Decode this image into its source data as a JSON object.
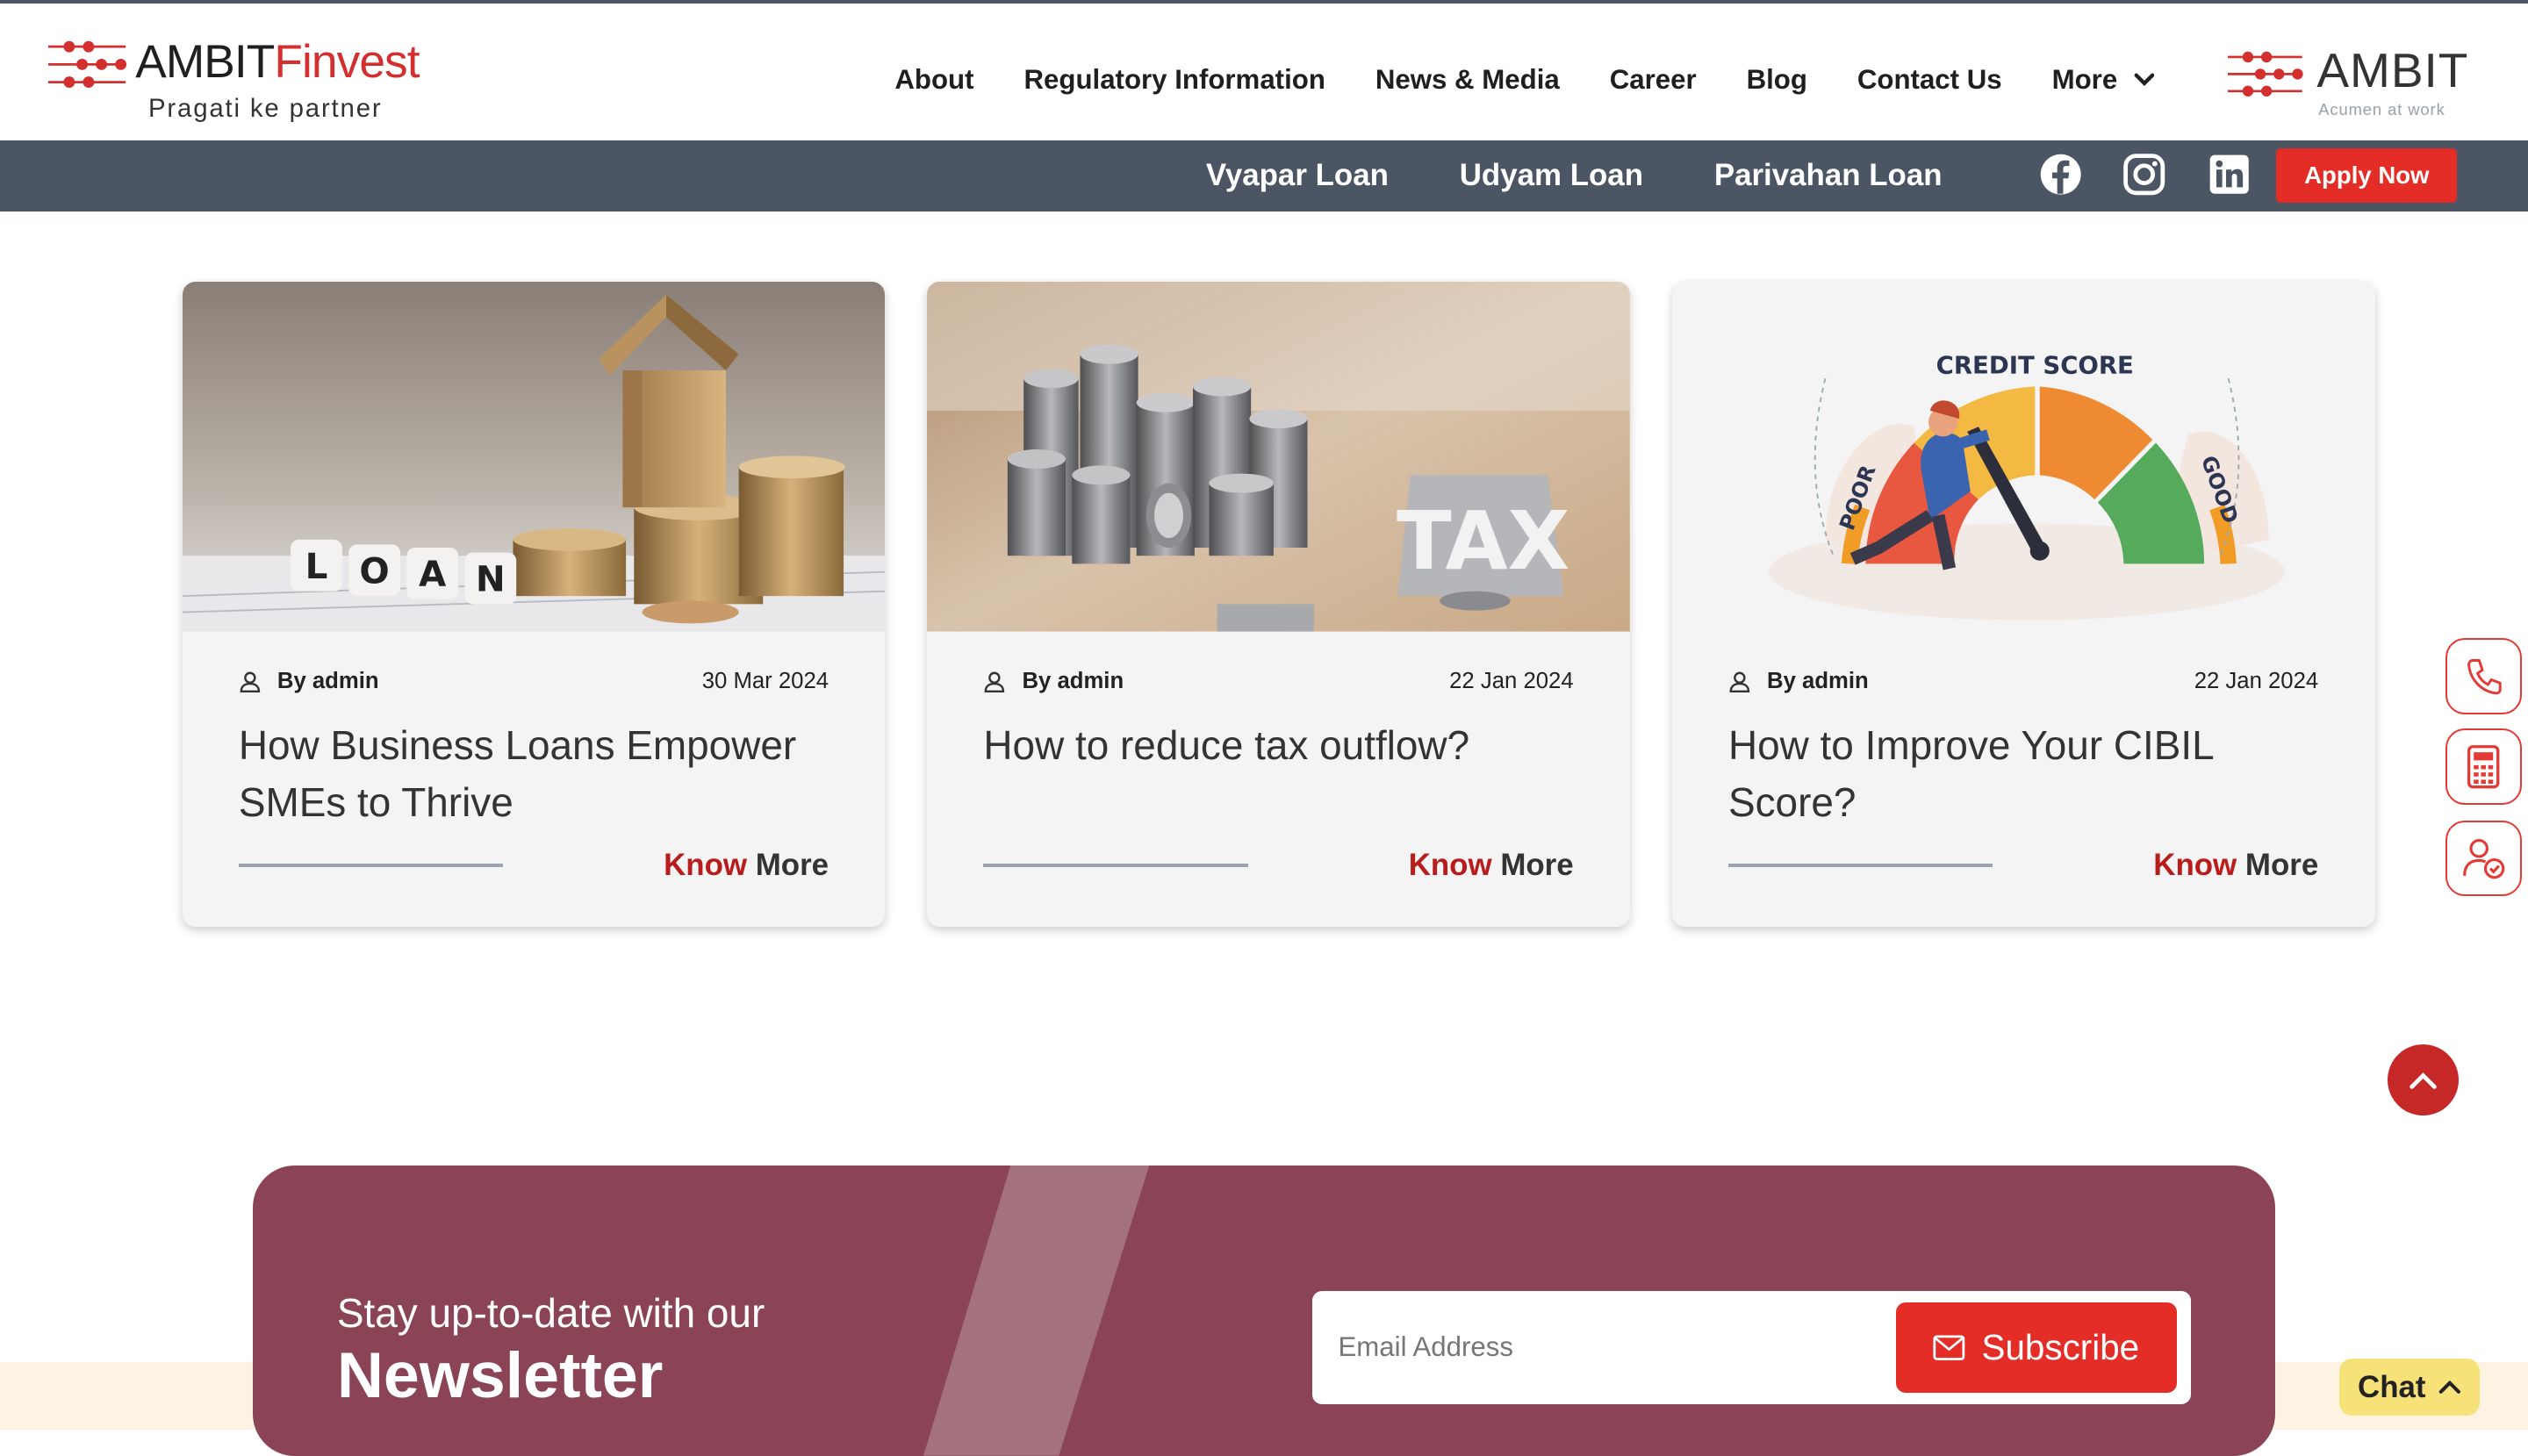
{
  "brand": {
    "name_main": "AMBIT",
    "name_accent": "Finvest",
    "tagline": "Pragati ke partner",
    "parent_name": "AMBIT",
    "parent_tagline": "Acumen at work"
  },
  "nav": {
    "items": [
      "About",
      "Regulatory Information",
      "News & Media",
      "Career",
      "Blog",
      "Contact Us"
    ],
    "more_label": "More"
  },
  "subnav": {
    "links": [
      "Vyapar Loan",
      "Udyam Loan",
      "Parivahan Loan"
    ],
    "apply_label": "Apply Now",
    "social_icons": [
      "facebook-icon",
      "instagram-icon",
      "linkedin-icon"
    ]
  },
  "cards": [
    {
      "author": "By admin",
      "date": "30 Mar 2024",
      "title": "How Business Loans Empower SMEs to Thrive",
      "cta_first": "Know",
      "cta_second": "More",
      "image_text": [
        "L",
        "O",
        "A",
        "N"
      ]
    },
    {
      "author": "By admin",
      "date": "22 Jan 2024",
      "title": "How to reduce tax outflow?",
      "cta_first": "Know",
      "cta_second": "More",
      "image_text": "TAX"
    },
    {
      "author": "By admin",
      "date": "22 Jan 2024",
      "title": "How to Improve Your CIBIL Score?",
      "cta_first": "Know",
      "cta_second": "More",
      "image_text": {
        "title": "CREDIT SCORE",
        "left": "POOR",
        "right": "GOOD"
      }
    }
  ],
  "side_buttons": [
    "phone-icon",
    "calculator-icon",
    "user-check-icon"
  ],
  "newsletter": {
    "small": "Stay up-to-date with our",
    "big": "Newsletter",
    "email_placeholder": "Email Address",
    "subscribe_label": "Subscribe"
  },
  "chat": {
    "label": "Chat"
  },
  "colors": {
    "accent_red": "#e52d27",
    "subbar": "#4b5563",
    "newsletter_bg": "#8b4456",
    "chat_bg": "#f7e27a"
  }
}
